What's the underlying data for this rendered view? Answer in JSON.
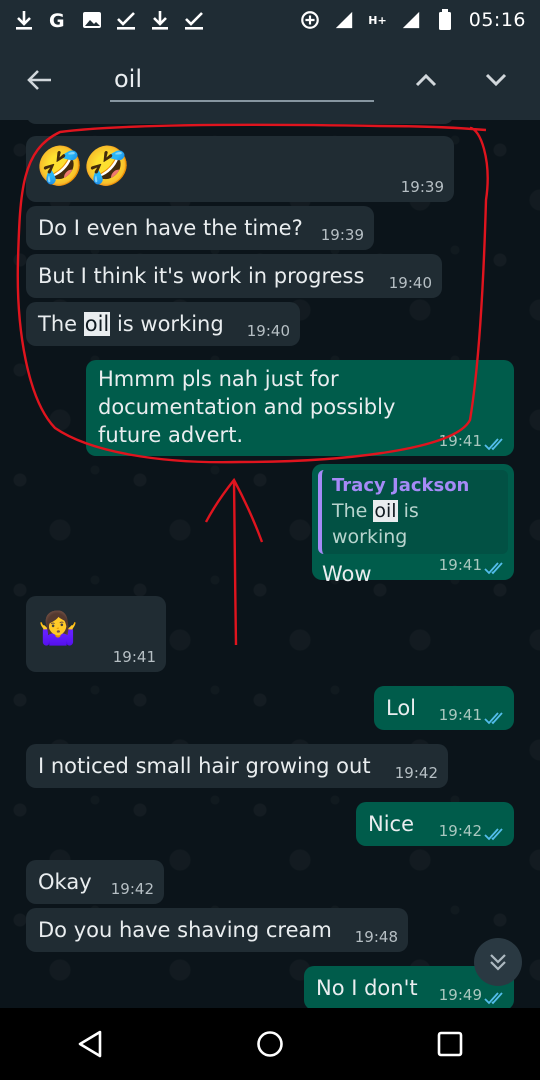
{
  "statusbar": {
    "time": "05:16",
    "network_label": "H+",
    "left_icons": [
      "download-icon",
      "google-icon",
      "image-icon",
      "check-icon",
      "download-icon",
      "check-icon"
    ]
  },
  "search": {
    "query": "oil"
  },
  "messages": [
    {
      "direction": "in",
      "emoji": "🤣🤣",
      "time": "19:39"
    },
    {
      "direction": "in",
      "text": "Do I even have the time?",
      "time": "19:39"
    },
    {
      "direction": "in",
      "text": "But I think it's work in progress",
      "time": "19:40"
    },
    {
      "direction": "in",
      "text_before": "The ",
      "highlight": "oil",
      "text_after": " is working",
      "time": "19:40"
    },
    {
      "direction": "out",
      "lines": [
        "Hmmm pls nah just for",
        "documentation and possibly",
        "future advert."
      ],
      "time": "19:41"
    },
    {
      "direction": "out",
      "quote_name": "Tracy Jackson",
      "quote_before": "The ",
      "quote_highlight": "oil",
      "quote_after": " is working",
      "text": "Wow",
      "time": "19:41"
    },
    {
      "direction": "in",
      "emoji": "🤷‍♀️",
      "time": "19:41"
    },
    {
      "direction": "out",
      "text": "Lol",
      "time": "19:41"
    },
    {
      "direction": "in",
      "text": "I noticed small hair growing out",
      "time": "19:42"
    },
    {
      "direction": "out",
      "text": "Nice",
      "time": "19:42"
    },
    {
      "direction": "in",
      "text": "Okay",
      "time": "19:42"
    },
    {
      "direction": "in",
      "text": "Do you have shaving cream",
      "time": "19:48"
    },
    {
      "direction": "out",
      "text": "No I don't",
      "time": "19:49"
    }
  ],
  "colors": {
    "incoming_bubble": "#202c33",
    "outgoing_bubble": "#005c4b",
    "read_ticks": "#53bdeb",
    "annotation": "#e0141e"
  }
}
